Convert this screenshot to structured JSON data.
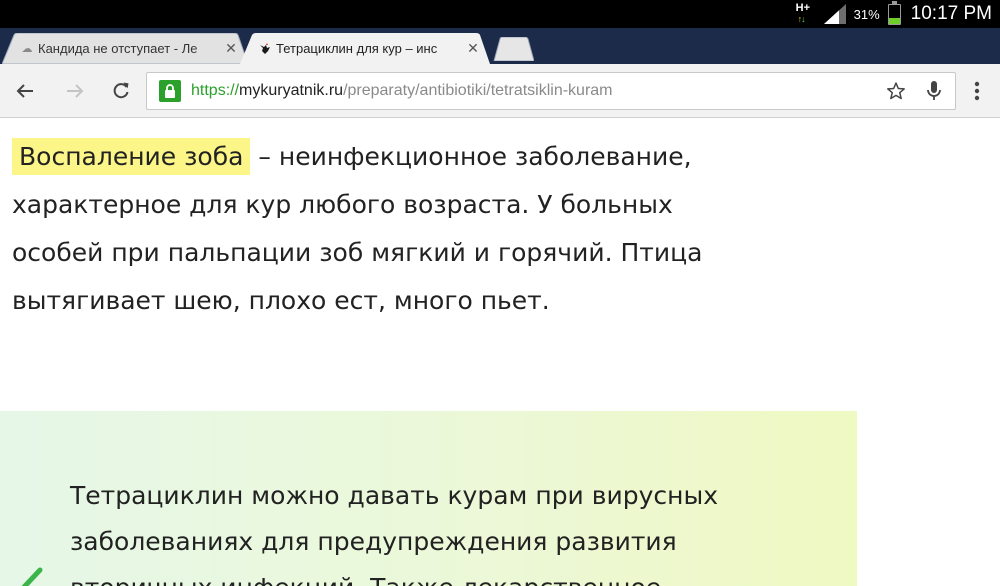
{
  "status_bar": {
    "network_type": "H+",
    "battery_percent": "31%",
    "battery_level": 0.31,
    "time": "10:17 PM"
  },
  "tabs": [
    {
      "title": "Кандида не отступает - Ле",
      "active": false,
      "icon": "site-favicon"
    },
    {
      "title": "Тетрациклин для кур – инс",
      "active": true,
      "icon": "rooster-favicon"
    }
  ],
  "toolbar": {
    "url_scheme": "https://",
    "url_domain": "mykuryatnik.ru",
    "url_path": "/preparaty/antibiotiki/tetratsiklin-kuram",
    "secure_color": "#2ba02b"
  },
  "article": {
    "highlight_term": "Воспаление зоба",
    "line1_rest": " – неинфекционное заболевание,",
    "line2": "характерное для кур любого возраста. У больных",
    "line3": "особей при пальпации зоб мягкий и горячий. Птица",
    "line4": "вытягивает шею, плохо ест, много пьет.",
    "highlight_color": "#fcf688"
  },
  "tip": {
    "line1": "Тетрациклин можно давать курам при вирусных",
    "line2": "заболеваниях для предупреждения развития",
    "line3": "вторичных инфекций. Также лекарственное",
    "icon": "checkmark-icon",
    "accent_color": "#3bb54a"
  }
}
